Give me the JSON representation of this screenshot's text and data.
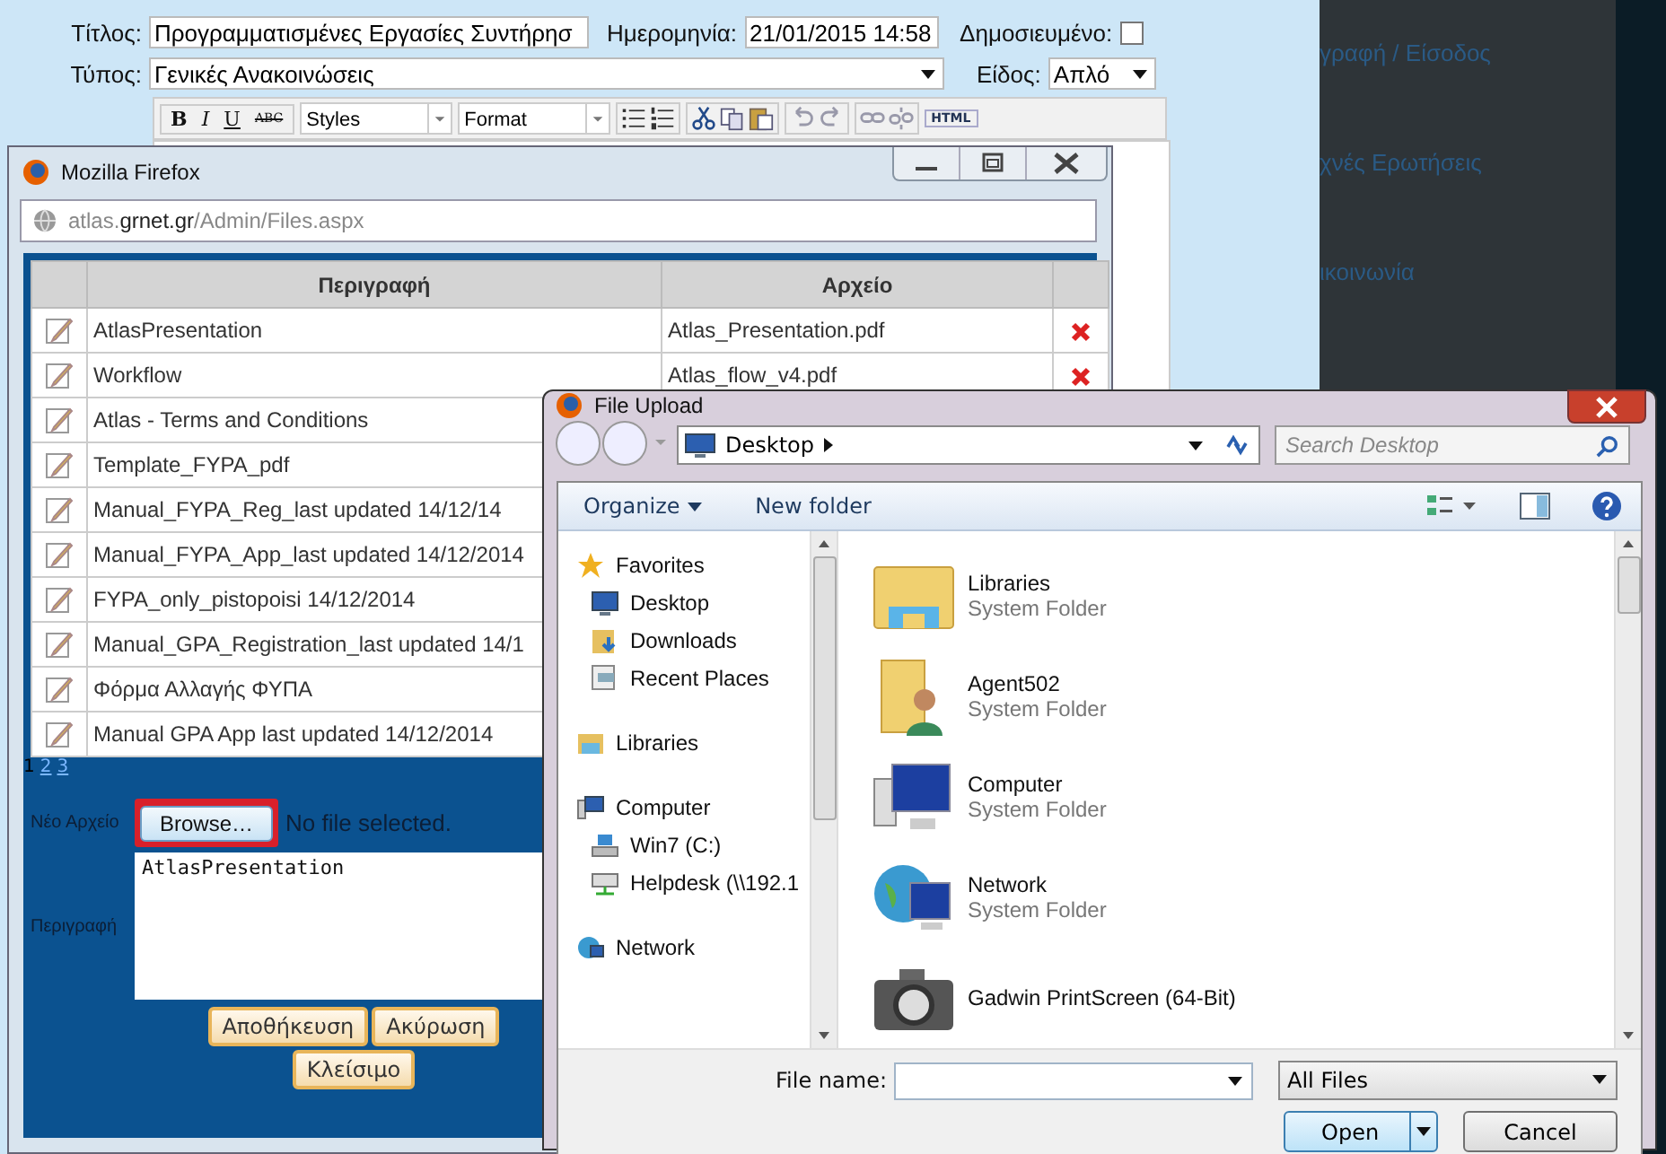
{
  "page": {
    "title_label": "Τίτλος:",
    "title_value": "Προγραμματισμένες Εργασίες Συντήρησ",
    "date_label": "Ημερομηνία:",
    "date_value": "21/01/2015 14:58",
    "published_label": "Δημοσιευμένο:",
    "published": false,
    "type_label": "Τύπος:",
    "type_value": "Γενικές Ανακοινώσεις",
    "kind_label": "Είδος:",
    "kind_value": "Απλό",
    "editor_toolbar": {
      "bold": "B",
      "italic": "I",
      "underline": "U",
      "strike": "ABC",
      "styles": "Styles",
      "format": "Format",
      "html": "HTML"
    },
    "side_links": [
      "γραφή / Είσοδος",
      "χνές Ερωτήσεις",
      "ικοινωνία"
    ]
  },
  "browser_window": {
    "title": "Mozilla Firefox",
    "url": {
      "prefix": "atlas.",
      "domain": "grnet.gr",
      "path": "/Admin/Files.aspx"
    },
    "table": {
      "columns": [
        "Περιγραφή",
        "Αρχείο"
      ],
      "rows": [
        {
          "description": "AtlasPresentation",
          "file": "Atlas_Presentation.pdf"
        },
        {
          "description": "Workflow",
          "file": "Atlas_flow_v4.pdf"
        },
        {
          "description": "Atlas - Terms and Conditions"
        },
        {
          "description": "Template_FYPA_pdf"
        },
        {
          "description": "Manual_FYPA_Reg_last updated 14/12/14"
        },
        {
          "description": "Manual_FYPA_App_last updated 14/12/2014"
        },
        {
          "description": "FYPA_only_pistopoisi 14/12/2014"
        },
        {
          "description": "Manual_GPA_Registration_last updated 14/1"
        },
        {
          "description": "Φόρμα Αλλαγής ΦΥΠΑ"
        },
        {
          "description": "Manual GPA App last updated 14/12/2014"
        }
      ]
    },
    "pager": [
      {
        "label": "1",
        "selected": true
      },
      {
        "label": "2",
        "selected": false
      },
      {
        "label": "3",
        "selected": false
      }
    ],
    "form": {
      "new_file_label": "Νέο Αρχείο",
      "browse": "Browse…",
      "browse_highlighted": true,
      "no_file": "No file selected.",
      "description_label": "Περιγραφή",
      "description_value": "AtlasPresentation",
      "buttons": [
        "Αποθήκευση",
        "Ακύρωση",
        "Κλείσιμο"
      ]
    }
  },
  "file_dialog": {
    "title": "File Upload",
    "location": "Desktop",
    "search_placeholder": "Search Desktop",
    "toolbar": {
      "organize": "Organize",
      "new_folder": "New folder"
    },
    "nav": [
      {
        "label": "Favorites",
        "kind": "group"
      },
      {
        "label": "Desktop",
        "kind": "item"
      },
      {
        "label": "Downloads",
        "kind": "item"
      },
      {
        "label": "Recent Places",
        "kind": "item"
      },
      {
        "label": "Libraries",
        "kind": "group"
      },
      {
        "label": "Computer",
        "kind": "group"
      },
      {
        "label": "Win7 (C:)",
        "kind": "item"
      },
      {
        "label": "Helpdesk (\\\\192.1",
        "kind": "item"
      },
      {
        "label": "Network",
        "kind": "group"
      }
    ],
    "files": [
      {
        "name": "Libraries",
        "type": "System Folder"
      },
      {
        "name": "Agent502",
        "type": "System Folder"
      },
      {
        "name": "Computer",
        "type": "System Folder"
      },
      {
        "name": "Network",
        "type": "System Folder"
      },
      {
        "name": "Gadwin PrintScreen (64-Bit)"
      }
    ],
    "filename_label": "File name:",
    "filter": "All Files",
    "open": "Open",
    "cancel": "Cancel"
  }
}
